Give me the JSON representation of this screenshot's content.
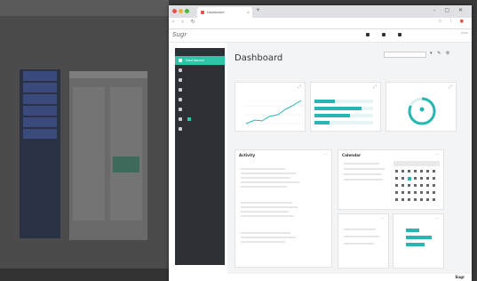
{
  "browser": {
    "tab_title": "Dashboard",
    "url": "",
    "win_controls": "– ▢ ✕",
    "tool_glyphs": "☆ ⋮"
  },
  "app": {
    "logo": "Sugr",
    "org_name": "",
    "top_links": [
      "",
      "",
      ""
    ],
    "signin": ""
  },
  "sidebar": {
    "items": [
      {
        "label": "Dashboard",
        "active": true
      },
      {
        "label": "",
        "active": false
      },
      {
        "label": "",
        "active": false
      },
      {
        "label": "",
        "active": false
      },
      {
        "label": "",
        "active": false
      },
      {
        "label": "",
        "active": false
      },
      {
        "label": "",
        "active": false,
        "badge": ""
      },
      {
        "label": "",
        "active": false
      }
    ]
  },
  "dashboard": {
    "title": "Dashboard",
    "subtitle": "",
    "cards": [
      {
        "title": "",
        "kind": "line-chart"
      },
      {
        "title": "",
        "kind": "bars",
        "bars": [
          0.35,
          0.8,
          0.6,
          0.25
        ]
      },
      {
        "title": "",
        "kind": "donut",
        "value": 0.82
      }
    ],
    "section_label": "",
    "activity": {
      "title": "Activity",
      "groups": [
        "",
        "",
        ""
      ]
    },
    "calendar": {
      "title": "Calendar",
      "month": ""
    },
    "panel_a": {
      "title": "",
      "link": ""
    },
    "panel_b": {
      "title": "",
      "bars": [
        0.4,
        0.75,
        0.55
      ]
    }
  },
  "footer": {
    "links": [
      "",
      "",
      "",
      ""
    ],
    "brand": "Sugr"
  },
  "colors": {
    "accent": "#2ec4a8",
    "teal": "#27b7b3",
    "sidebar_bg": "#2d3136"
  }
}
